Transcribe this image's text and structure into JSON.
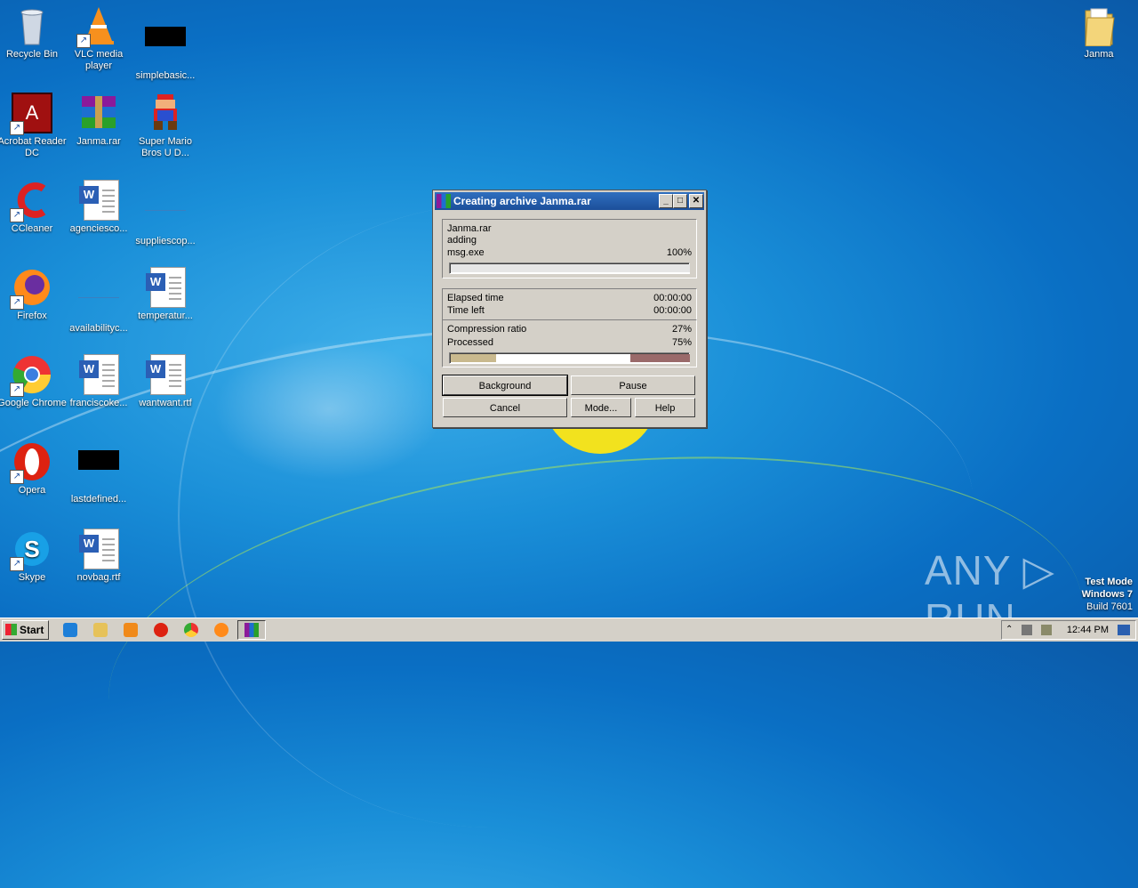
{
  "desktop": {
    "icons": [
      {
        "label": "Recycle Bin"
      },
      {
        "label": "VLC media player"
      },
      {
        "label": "simplebasic..."
      },
      {
        "label": "Acrobat Reader DC"
      },
      {
        "label": "Janma.rar"
      },
      {
        "label": "Super Mario Bros U D..."
      },
      {
        "label": "CCleaner"
      },
      {
        "label": "agenciesco..."
      },
      {
        "label": "suppliescop..."
      },
      {
        "label": "Firefox"
      },
      {
        "label": "availabilityc..."
      },
      {
        "label": "temperatur..."
      },
      {
        "label": "Google Chrome"
      },
      {
        "label": "franciscoke..."
      },
      {
        "label": "wantwant.rtf"
      },
      {
        "label": "Opera"
      },
      {
        "label": "lastdefined..."
      },
      {
        "label": "Skype"
      },
      {
        "label": "novbag.rtf"
      },
      {
        "label": "Janma"
      }
    ]
  },
  "dialog": {
    "title": "Creating archive Janma.rar",
    "archive_name": "Janma.rar",
    "action": "adding",
    "current_file": "msg.exe",
    "file_percent": "100%",
    "file_progress": 1.0,
    "elapsed_label": "Elapsed time",
    "elapsed_value": "00:00:00",
    "timeleft_label": "Time left",
    "timeleft_value": "00:00:00",
    "ratio_label": "Compression ratio",
    "ratio_value": "27%",
    "processed_label": "Processed",
    "processed_value": "75%",
    "ratio_fraction": 0.27,
    "processed_fraction": 0.75,
    "buttons": {
      "background": "Background",
      "pause": "Pause",
      "cancel": "Cancel",
      "mode": "Mode...",
      "help": "Help"
    }
  },
  "watermark": {
    "brand": "ANY ▷ RUN",
    "test_mode": "Test Mode",
    "os": "Windows 7",
    "build": "Build 7601"
  },
  "taskbar": {
    "start_label": "Start",
    "clock": "12:44 PM"
  },
  "colors": {
    "ratio_bar": "#c9b98e",
    "processed_bar": "#9a6a6a",
    "title_bar": "#1c4f9a"
  }
}
